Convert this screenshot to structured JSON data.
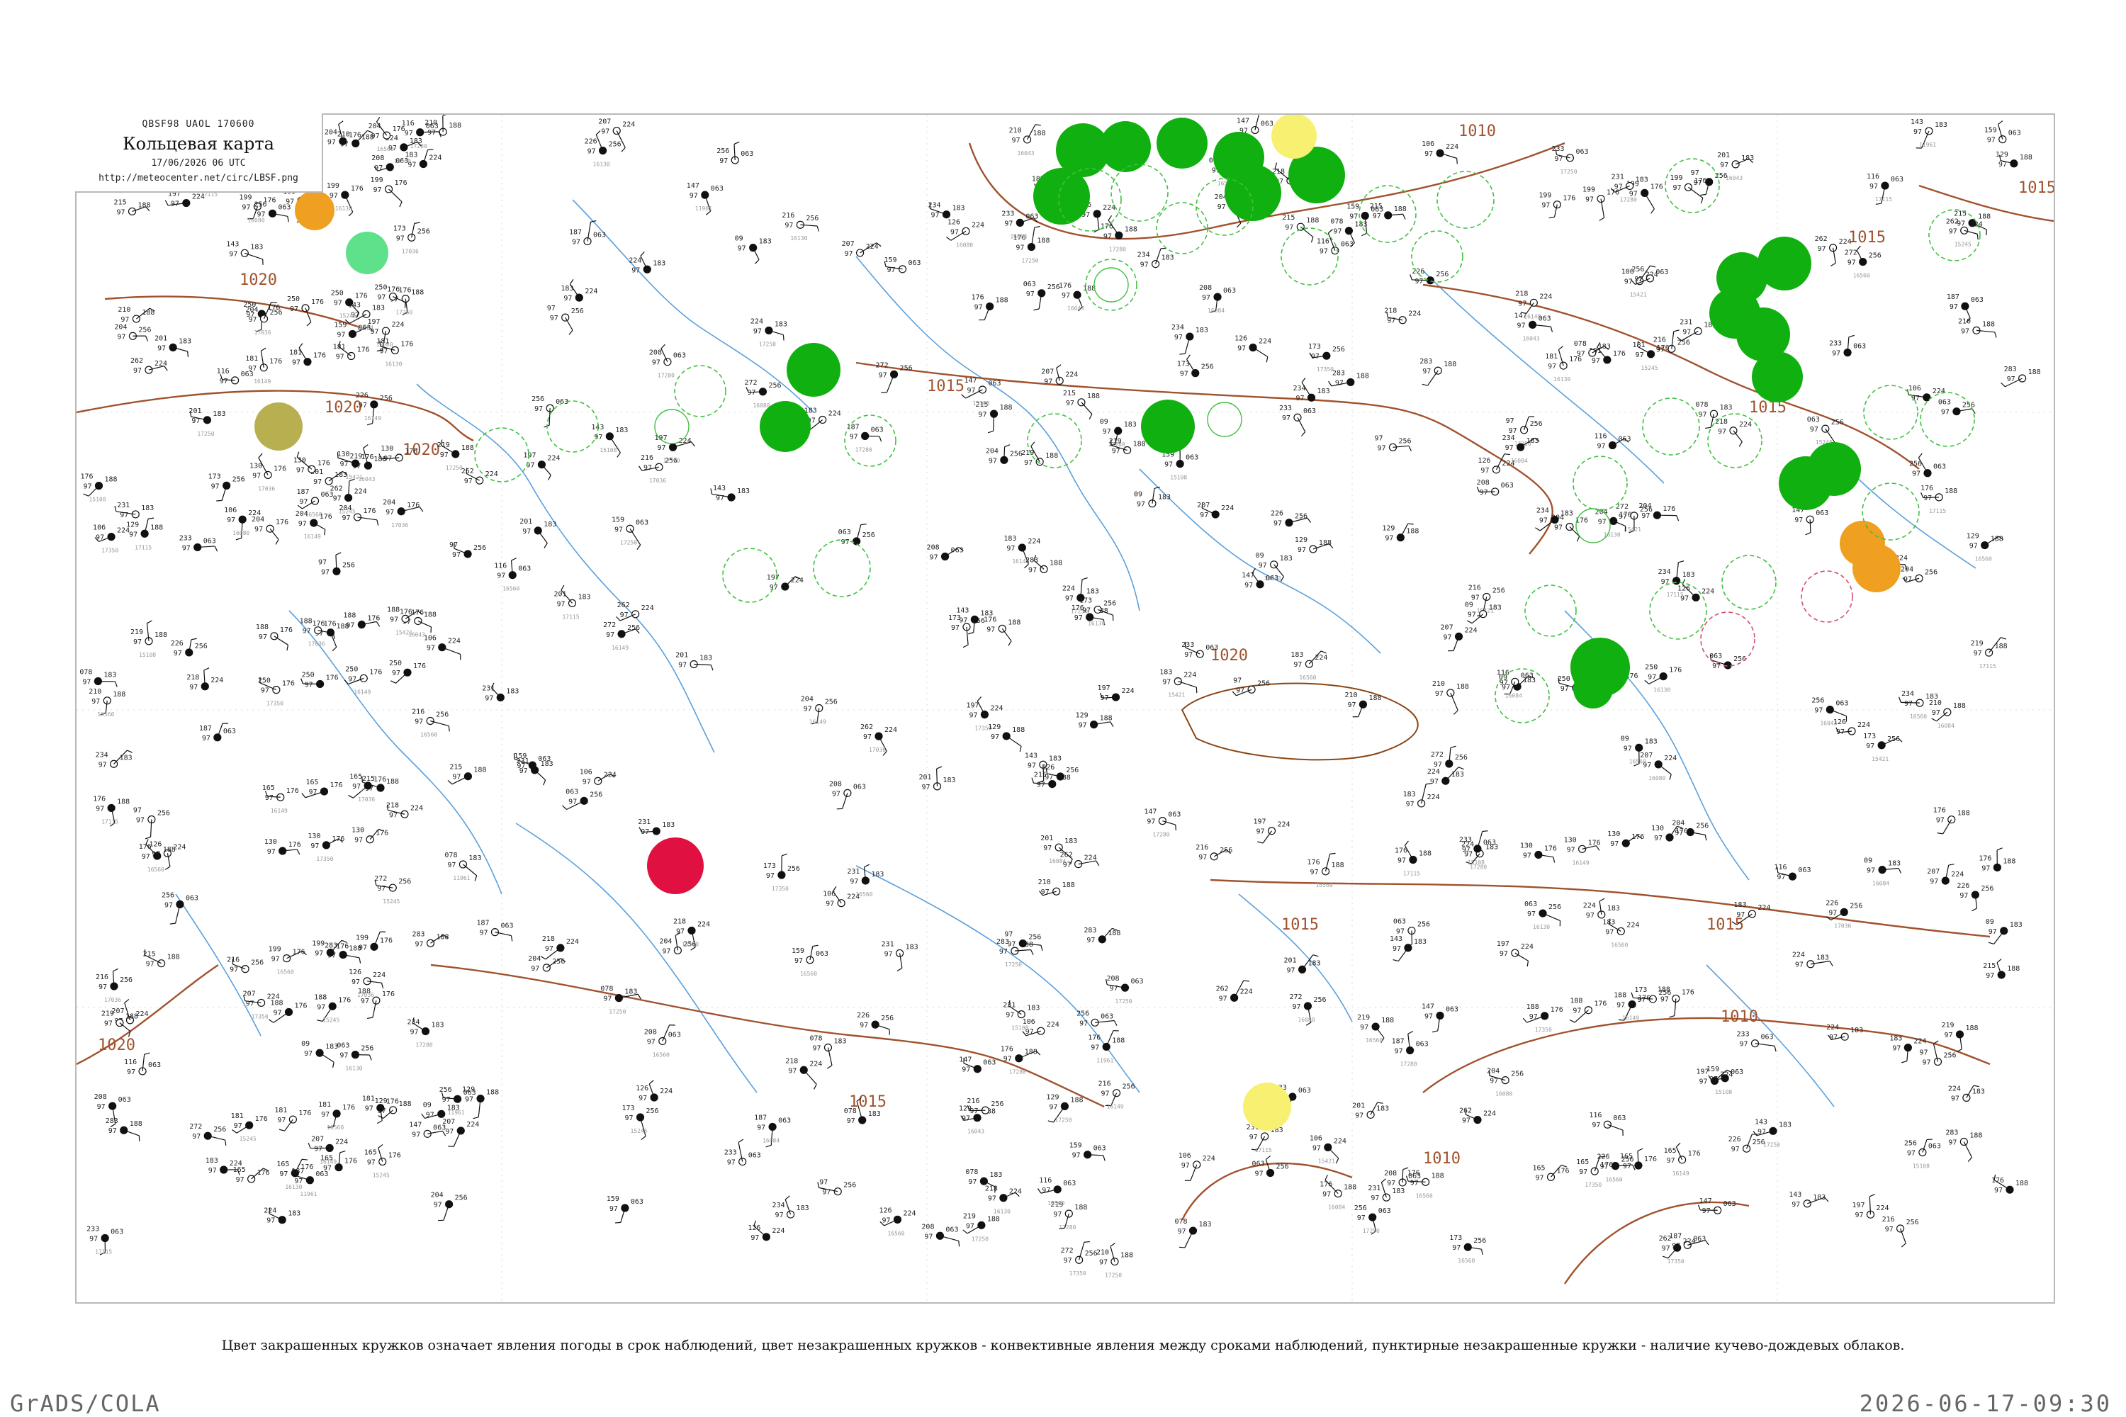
{
  "header": {
    "code_line": "QBSF98  UAOL  170600",
    "title": "Кольцевая карта",
    "time": "17/06/2026 06 UTC",
    "url": "http://meteocenter.net/circ/LBSF.png"
  },
  "caption": "Цвет закрашенных кружков означает явления погоды в срок наблюдений, цвет незакрашенных кружков - конвективные явления между сроками наблюдений, пунктирные незакрашенные кружки - наличие кучево-дождевых облаков.",
  "footer": {
    "left": "GrADS/COLA",
    "right": "2026-06-17-09:30"
  },
  "colors": {
    "isobar": "#a0522d",
    "river": "#5aa0dc",
    "frame": "#b9b9b9",
    "green_fill": "#10b010",
    "light_green_fill": "#5fe08a",
    "orange_fill": "#f0a020",
    "olive_fill": "#b8b050",
    "yellow_fill": "#f8f070",
    "red_fill": "#e01040",
    "dashed_green": "#40c040",
    "dashed_pink": "#d05070"
  },
  "isobar_labels": [
    "1020",
    "1020",
    "1020",
    "1015",
    "1015",
    "1015",
    "1015",
    "1015",
    "1015",
    "1010",
    "1010",
    "1010",
    "1020",
    "1015",
    "1020"
  ],
  "station_values": [
    "143",
    "181",
    "159",
    "183",
    "176",
    "97",
    "09",
    "165",
    "147",
    "126",
    "176",
    "173",
    "078",
    "130",
    "116",
    "106",
    "129",
    "063",
    "201",
    "204",
    "187",
    "197",
    "215",
    "216",
    "224",
    "199",
    "208",
    "207",
    "219",
    "226",
    "234",
    "188",
    "233",
    "218",
    "210",
    "204",
    "231",
    "250",
    "256",
    "262",
    "283",
    "272"
  ],
  "station_ids": [
    "16043",
    "15245",
    "16084",
    "15421",
    "11961",
    "16130",
    "15108",
    "17036",
    "17280",
    "16080",
    "17115",
    "16149",
    "17250",
    "16560",
    "16560",
    "17350"
  ],
  "fills": {
    "green": "green",
    "light_green": "light green",
    "orange": "orange",
    "olive": "olive",
    "yellow": "yellow",
    "red": "red"
  }
}
